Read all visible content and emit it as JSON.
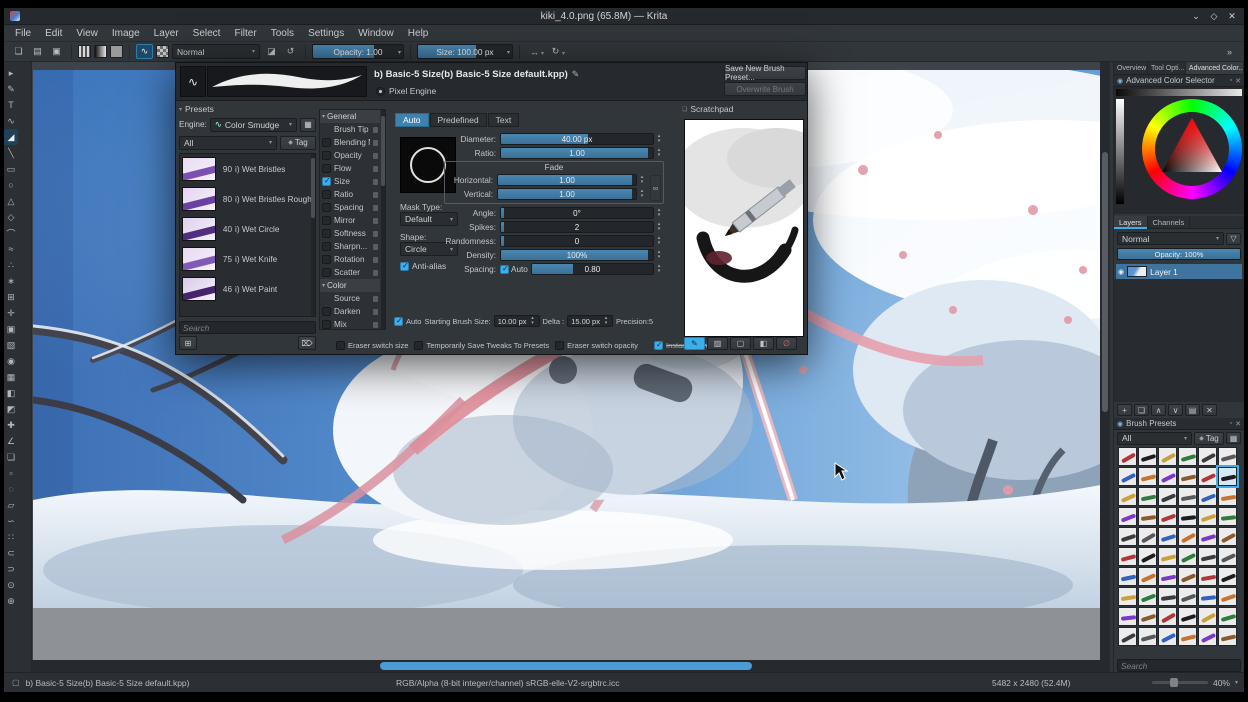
{
  "window": {
    "title": "kiki_4.0.png (65.8M) — Krita",
    "controls": {
      "minimize": "⌄",
      "maximize": "◇",
      "close": "✕"
    }
  },
  "menubar": [
    "File",
    "Edit",
    "View",
    "Image",
    "Layer",
    "Select",
    "Filter",
    "Tools",
    "Settings",
    "Window",
    "Help"
  ],
  "toolbar": {
    "file_icons": [
      {
        "name": "new-document-button",
        "glyph": "❏"
      },
      {
        "name": "open-document-button",
        "glyph": "▤"
      },
      {
        "name": "save-document-button",
        "glyph": "▣"
      }
    ],
    "brush_chooser_icon": "∿",
    "blend_mode": "Normal",
    "mid_icons": [
      {
        "name": "eraser-toggle-button",
        "glyph": "◪"
      },
      {
        "name": "reload-preset-button",
        "glyph": "↺"
      }
    ],
    "opacity_text": "Opacity:  1.00",
    "opacity_fill": 0.68,
    "size_text": "Size:  100.00 px",
    "size_fill": 0.62,
    "mirror_icons": [
      {
        "name": "mirror-horizontal-button",
        "glyph": "↔"
      },
      {
        "name": "mirror-vertical-button",
        "glyph": "↻"
      }
    ],
    "overflow_icon": "»"
  },
  "toolbox": [
    {
      "name": "shape-select-tool",
      "glyph": "▸"
    },
    {
      "name": "edit-shapes-tool",
      "glyph": "✎"
    },
    {
      "name": "text-tool",
      "glyph": "T"
    },
    {
      "name": "calligraphy-tool",
      "glyph": "∿"
    },
    {
      "name": "freehand-brush-tool",
      "glyph": "◢",
      "active": true
    },
    {
      "name": "line-tool",
      "glyph": "╲"
    },
    {
      "name": "rectangle-tool",
      "glyph": "▭"
    },
    {
      "name": "ellipse-tool",
      "glyph": "○"
    },
    {
      "name": "polygon-tool",
      "glyph": "△"
    },
    {
      "name": "polyline-tool",
      "glyph": "◇"
    },
    {
      "name": "bezier-curve-tool",
      "glyph": "⌒"
    },
    {
      "name": "freehand-path-tool",
      "glyph": "≈"
    },
    {
      "name": "dynamic-brush-tool",
      "glyph": "∴"
    },
    {
      "name": "multibrush-tool",
      "glyph": "∗"
    },
    {
      "name": "transform-tool",
      "glyph": "⊞"
    },
    {
      "name": "move-tool",
      "glyph": "✛"
    },
    {
      "name": "crop-tool",
      "glyph": "▣"
    },
    {
      "name": "gradient-tool",
      "glyph": "▧"
    },
    {
      "name": "color-sampler-tool",
      "glyph": "◉"
    },
    {
      "name": "pattern-editing-tool",
      "glyph": "▦"
    },
    {
      "name": "fill-tool",
      "glyph": "◧"
    },
    {
      "name": "enclose-and-fill-tool",
      "glyph": "◩"
    },
    {
      "name": "assistants-tool",
      "glyph": "✚"
    },
    {
      "name": "measure-tool",
      "glyph": "∠"
    },
    {
      "name": "reference-images-tool",
      "glyph": "❏"
    },
    {
      "name": "rectangular-selection-tool",
      "glyph": "▫"
    },
    {
      "name": "elliptical-selection-tool",
      "glyph": "◌"
    },
    {
      "name": "polygonal-selection-tool",
      "glyph": "▱"
    },
    {
      "name": "freehand-selection-tool",
      "glyph": "∽"
    },
    {
      "name": "similar-color-selection-tool",
      "glyph": "∷"
    },
    {
      "name": "bezier-selection-tool",
      "glyph": "⊂"
    },
    {
      "name": "magnetic-selection-tool",
      "glyph": "⊃"
    },
    {
      "name": "zoom-tool",
      "glyph": "⊙"
    },
    {
      "name": "pan-tool",
      "glyph": "⊕"
    }
  ],
  "dialog": {
    "title": "b) Basic-5 Size(b) Basic-5 Size default.kpp)",
    "edit_icon": "✎",
    "engine_radio": "Pixel Engine",
    "save_button": "Save New Brush Preset...",
    "overwrite_button": "Overwrite Brush",
    "presets": {
      "header": "Presets",
      "engine_label": "Engine:",
      "engine_icon": "∿",
      "engine_value": "Color Smudge",
      "filter_value": "All",
      "tag_icon": "◆",
      "tag_label": "Tag",
      "search_placeholder": "Search",
      "add_icon": "⊞",
      "delete_icon": "⌦",
      "items": [
        {
          "num": "90",
          "name": "i) Wet Bristles",
          "c1": "#e9dcf4",
          "c2": "#7b50b2"
        },
        {
          "num": "80",
          "name": "i) Wet Bristles Rough",
          "c1": "#e4d5f0",
          "c2": "#6a40a2"
        },
        {
          "num": "40",
          "name": "i) Wet Circle",
          "c1": "#dfd2ec",
          "c2": "#512f80"
        },
        {
          "num": "75",
          "name": "i) Wet Knife",
          "c1": "#e7daf2",
          "c2": "#8159b6"
        },
        {
          "num": "46",
          "name": "i) Wet Paint",
          "c1": "#dacaea",
          "c2": "#44256c"
        }
      ]
    },
    "options": {
      "rows": [
        {
          "t": "h",
          "label": "General"
        },
        {
          "t": "i",
          "label": "Brush Tip",
          "cb": false,
          "on": false
        },
        {
          "t": "i",
          "label": "Blending M...",
          "cb": true,
          "on": false
        },
        {
          "t": "i",
          "label": "Opacity",
          "cb": true,
          "on": false
        },
        {
          "t": "i",
          "label": "Flow",
          "cb": true,
          "on": false
        },
        {
          "t": "i",
          "label": "Size",
          "cb": true,
          "on": true
        },
        {
          "t": "i",
          "label": "Ratio",
          "cb": true,
          "on": false
        },
        {
          "t": "i",
          "label": "Spacing",
          "cb": true,
          "on": false
        },
        {
          "t": "i",
          "label": "Mirror",
          "cb": true,
          "on": false
        },
        {
          "t": "i",
          "label": "Softness",
          "cb": true,
          "on": false
        },
        {
          "t": "i",
          "label": "Sharpn...",
          "cb": true,
          "on": false
        },
        {
          "t": "i",
          "label": "Rotation",
          "cb": true,
          "on": false
        },
        {
          "t": "i",
          "label": "Scatter",
          "cb": true,
          "on": false
        },
        {
          "t": "h",
          "label": "Color"
        },
        {
          "t": "i",
          "label": "Source",
          "cb": false,
          "on": false
        },
        {
          "t": "i",
          "label": "Darken",
          "cb": true,
          "on": false
        },
        {
          "t": "i",
          "label": "Mix",
          "cb": true,
          "on": false
        }
      ]
    },
    "tip": {
      "tabs": [
        "Auto",
        "Predefined",
        "Text"
      ],
      "active_tab": 0,
      "mask_type_label": "Mask Type:",
      "mask_type_value": "Default",
      "shape_label": "Shape:",
      "shape_value": "Circle",
      "antialias_label": "Anti-alias",
      "antialias_on": true,
      "sliders": [
        {
          "id": "diameter",
          "label": "Diameter:",
          "value": "40.00 px",
          "fill": 0.57
        },
        {
          "id": "ratio",
          "label": "Ratio:",
          "value": "1.00",
          "fill": 0.97
        }
      ],
      "fade": {
        "title": "Fade",
        "link_icon": "∞",
        "sliders": [
          {
            "id": "horizontal",
            "label": "Horizontal:",
            "value": "1.00",
            "fill": 0.97
          },
          {
            "id": "vertical",
            "label": "Vertical:",
            "value": "1.00",
            "fill": 0.97
          }
        ]
      },
      "sliders2": [
        {
          "id": "angle",
          "label": "Angle:",
          "value": "0°",
          "fill": 0.02
        },
        {
          "id": "spikes",
          "label": "Spikes:",
          "value": "2",
          "fill": 0.02
        },
        {
          "id": "randomness",
          "label": "Randomness:",
          "value": "0",
          "fill": 0.02
        },
        {
          "id": "density",
          "label": "Density:",
          "value": "100%",
          "fill": 0.97
        }
      ],
      "spacing": {
        "label": "Spacing:",
        "auto_label": "Auto",
        "auto_on": true,
        "value": "0.80",
        "fill": 0.34
      },
      "footer": {
        "auto_label": "Auto",
        "auto_on": true,
        "starting_label": "Starting Brush Size:",
        "starting_value": "10.00 px",
        "delta_label": "Delta :",
        "delta_value": "15.00 px",
        "precision": "Precision:5"
      }
    },
    "scratchpad": {
      "title": "Scratchpad",
      "buttons": [
        {
          "name": "scratchpad-paint-button",
          "glyph": "✎",
          "active": true
        },
        {
          "name": "scratchpad-fill-gradient-button",
          "glyph": "▨"
        },
        {
          "name": "scratchpad-fill-background-button",
          "glyph": "▢"
        },
        {
          "name": "scratchpad-fill-color-button",
          "glyph": "◧"
        },
        {
          "name": "scratchpad-reset-button",
          "glyph": "∅",
          "danger": true
        }
      ]
    },
    "footer_checks": [
      {
        "label": "Eraser switch size",
        "on": false
      },
      {
        "label": "Temporarily Save Tweaks To Presets",
        "on": false
      },
      {
        "label": "Eraser switch opacity",
        "on": false
      }
    ],
    "instant_preview": {
      "label": "Instant Preview",
      "on": true
    }
  },
  "dock": {
    "tabs": [
      "Overview",
      "Tool Opti...",
      "Advanced Color..."
    ],
    "active_tab": 2,
    "float_icon": "▫",
    "close_icon": "✕",
    "docker_icon": "◉",
    "color_selector": {
      "title": "Advanced Color Selector"
    },
    "layers": {
      "tabs": [
        "Layers",
        "Channels"
      ],
      "active_tab": 0,
      "blend_mode": "Normal",
      "filter_icon": "▽",
      "opacity_text": "Opacity:  100%",
      "opacity_fill": 1,
      "layer_name": "Layer 1",
      "eye_icon": "◉",
      "buttons": [
        {
          "name": "add-layer-button",
          "glyph": "+"
        },
        {
          "name": "duplicate-layer-button",
          "glyph": "❏"
        },
        {
          "name": "move-layer-up-button",
          "glyph": "∧"
        },
        {
          "name": "move-layer-down-button",
          "glyph": "∨"
        },
        {
          "name": "layer-properties-button",
          "glyph": "▤"
        },
        {
          "name": "delete-layer-button",
          "glyph": "✕"
        }
      ]
    },
    "brush_presets": {
      "title": "Brush Presets",
      "filter_value": "All",
      "tag_icon": "◆",
      "tag_label": "Tag",
      "grid_icon": "▦",
      "search_placeholder": "Search",
      "grid": {
        "cols": 6,
        "rows": 10,
        "selected_index": 11,
        "palette": [
          "#1d1d1f",
          "#3c3c40",
          "#c9722e",
          "#b23636",
          "#2f7d3c",
          "#2f62c4",
          "#8a5a2e",
          "#c8a13b",
          "#58585c",
          "#7a38c9"
        ]
      }
    }
  },
  "statusbar": {
    "left_icon": "▢",
    "brush_name": "b) Basic-5 Size(b) Basic-5 Size default.kpp)",
    "color_info": "RGB/Alpha (8-bit integer/channel)  sRGB-elle-V2-srgbtrc.icc",
    "dimensions": "5482 x 2480 (52.4M)",
    "zoom": "40%",
    "zoom_arrow": "▾"
  },
  "colors": {
    "accent": "#3daee9",
    "slider_fill": "#3f7aa6",
    "selection_blue": "#3f749f",
    "canvas_sky": "#5b95d3"
  }
}
